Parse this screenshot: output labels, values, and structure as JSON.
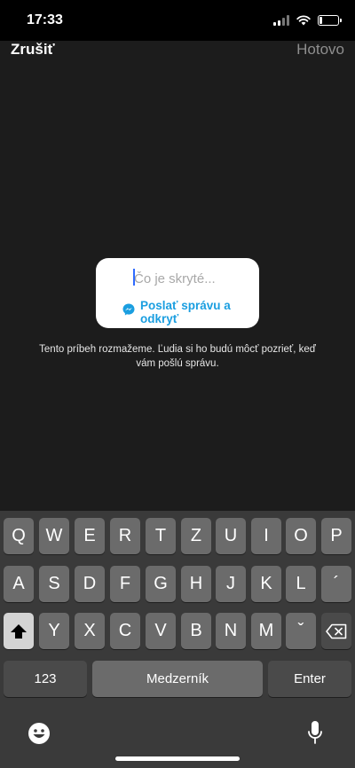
{
  "status_bar": {
    "time": "17:33",
    "icons": [
      "signal-icon",
      "wifi-icon",
      "battery-icon"
    ]
  },
  "editor": {
    "cancel_label": "Zrušiť",
    "done_label": "Hotovo",
    "hidden_card": {
      "placeholder": "Čo je skryté...",
      "value": "",
      "action_label": "Poslať správu a odkryť",
      "action_icon": "messenger-icon",
      "accent_color": "#1a9ee0"
    },
    "notice": "Tento príbeh rozmažeme. Ľudia si ho budú môcť pozrieť, keď vám pošlú správu."
  },
  "keyboard": {
    "row1": [
      "Q",
      "W",
      "E",
      "R",
      "T",
      "Z",
      "U",
      "I",
      "O",
      "P"
    ],
    "row2": [
      "A",
      "S",
      "D",
      "F",
      "G",
      "H",
      "J",
      "K",
      "L",
      "´"
    ],
    "row3": [
      "Y",
      "X",
      "C",
      "V",
      "B",
      "N",
      "M",
      "ˇ"
    ],
    "shift_icon": "shift-icon",
    "backspace_icon": "backspace-icon",
    "numbers_label": "123",
    "space_label": "Medzerník",
    "enter_label": "Enter",
    "emoji_icon": "emoji-icon",
    "mic_icon": "microphone-icon"
  }
}
